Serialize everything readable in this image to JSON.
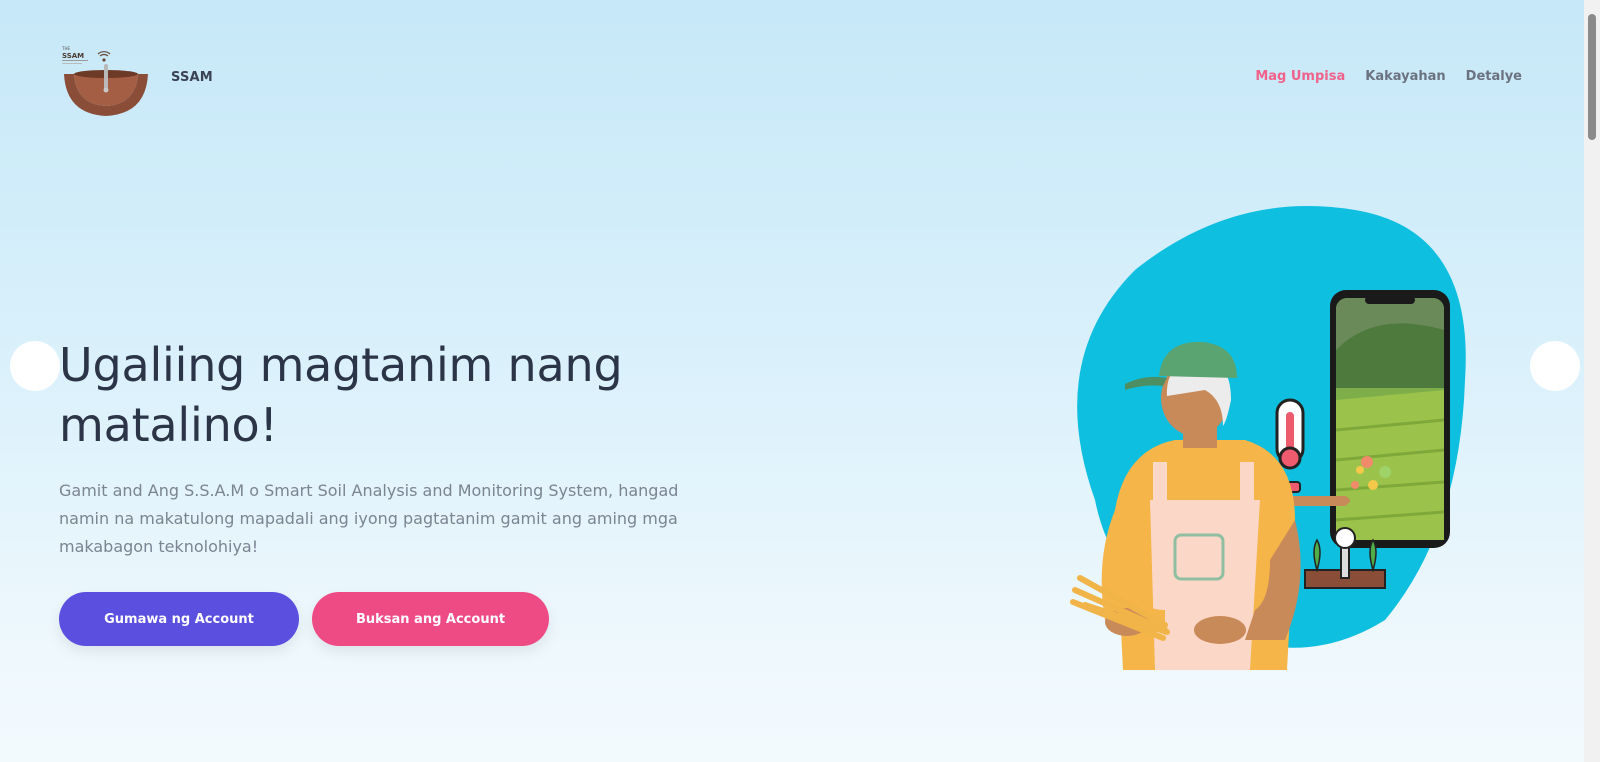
{
  "header": {
    "logo_text": "SSAM",
    "brand": "SSAM",
    "nav": [
      {
        "label": "Mag Umpisa",
        "active": true
      },
      {
        "label": "Kakayahan",
        "active": false
      },
      {
        "label": "Detalye",
        "active": false
      }
    ]
  },
  "hero": {
    "title": "Ugaliing magtanim nang matalino!",
    "description": "Gamit and Ang S.S.A.M o Smart Soil Analysis and Monitoring System, hangad namin na makatulong mapadali ang iyong pagtatanim gamit ang aming mga makabagon teknolohiya!",
    "buttons": {
      "create_account": "Gumawa ng Account",
      "open_account": "Buksan ang Account"
    }
  },
  "colors": {
    "nav_active": "#f0628a",
    "button_primary": "#5a4fde",
    "button_secondary": "#ee4b85",
    "illustration_blob": "#0fbfe0"
  },
  "icons": {
    "logo": "ssam-soil-logo-icon",
    "slider_prev": "slider-prev-icon",
    "slider_next": "slider-next-icon"
  }
}
